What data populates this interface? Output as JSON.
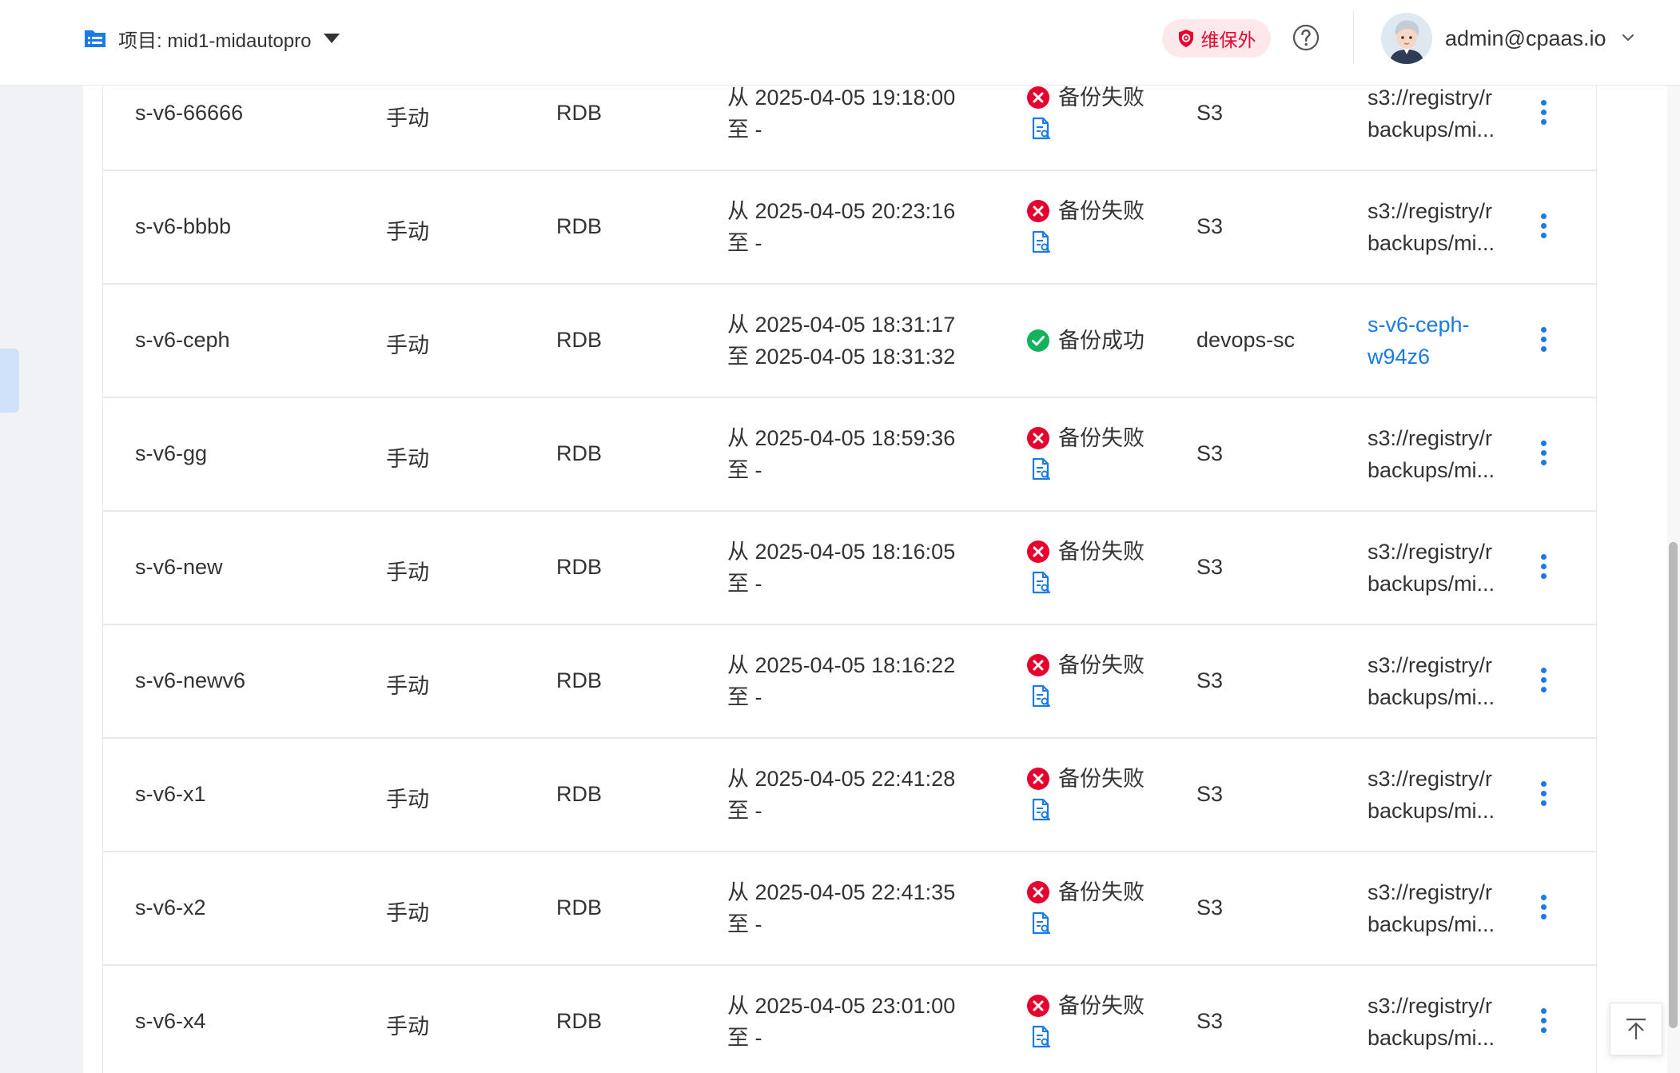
{
  "header": {
    "project_label": "项目: mid1-midautopro",
    "warranty_badge": "维保外",
    "user_email": "admin@cpaas.io"
  },
  "colors": {
    "accent": "#1a7ae6",
    "error": "#e6002d",
    "success": "#12b35a",
    "badge_bg": "#fde8eb",
    "page_bg": "#f0f2f5"
  },
  "icons": [
    "project-icon",
    "caret-down-icon",
    "shield-icon",
    "help-icon",
    "avatar",
    "chevron-down-icon",
    "error-icon",
    "success-icon",
    "log-file-icon",
    "more-icon",
    "back-to-top-icon"
  ],
  "rows": [
    {
      "name": "s-v6-66666",
      "mode": "手动",
      "type": "RDB",
      "time_from": "从 2025-04-05 19:18:00",
      "time_to": "至 -",
      "status": "备份失败",
      "status_kind": "error",
      "storage": "S3",
      "path_line1": "s3://registry/r",
      "path_line2": "backups/mi...",
      "path_is_link": false
    },
    {
      "name": "s-v6-bbbb",
      "mode": "手动",
      "type": "RDB",
      "time_from": "从 2025-04-05 20:23:16",
      "time_to": "至 -",
      "status": "备份失败",
      "status_kind": "error",
      "storage": "S3",
      "path_line1": "s3://registry/r",
      "path_line2": "backups/mi...",
      "path_is_link": false
    },
    {
      "name": "s-v6-ceph",
      "mode": "手动",
      "type": "RDB",
      "time_from": "从 2025-04-05 18:31:17",
      "time_to": "至 2025-04-05 18:31:32",
      "status": "备份成功",
      "status_kind": "success",
      "storage": "devops-sc",
      "path_line1": "s-v6-ceph-",
      "path_line2": "w94z6",
      "path_is_link": true
    },
    {
      "name": "s-v6-gg",
      "mode": "手动",
      "type": "RDB",
      "time_from": "从 2025-04-05 18:59:36",
      "time_to": "至 -",
      "status": "备份失败",
      "status_kind": "error",
      "storage": "S3",
      "path_line1": "s3://registry/r",
      "path_line2": "backups/mi...",
      "path_is_link": false
    },
    {
      "name": "s-v6-new",
      "mode": "手动",
      "type": "RDB",
      "time_from": "从 2025-04-05 18:16:05",
      "time_to": "至 -",
      "status": "备份失败",
      "status_kind": "error",
      "storage": "S3",
      "path_line1": "s3://registry/r",
      "path_line2": "backups/mi...",
      "path_is_link": false
    },
    {
      "name": "s-v6-newv6",
      "mode": "手动",
      "type": "RDB",
      "time_from": "从 2025-04-05 18:16:22",
      "time_to": "至 -",
      "status": "备份失败",
      "status_kind": "error",
      "storage": "S3",
      "path_line1": "s3://registry/r",
      "path_line2": "backups/mi...",
      "path_is_link": false
    },
    {
      "name": "s-v6-x1",
      "mode": "手动",
      "type": "RDB",
      "time_from": "从 2025-04-05 22:41:28",
      "time_to": "至 -",
      "status": "备份失败",
      "status_kind": "error",
      "storage": "S3",
      "path_line1": "s3://registry/r",
      "path_line2": "backups/mi...",
      "path_is_link": false
    },
    {
      "name": "s-v6-x2",
      "mode": "手动",
      "type": "RDB",
      "time_from": "从 2025-04-05 22:41:35",
      "time_to": "至 -",
      "status": "备份失败",
      "status_kind": "error",
      "storage": "S3",
      "path_line1": "s3://registry/r",
      "path_line2": "backups/mi...",
      "path_is_link": false
    },
    {
      "name": "s-v6-x4",
      "mode": "手动",
      "type": "RDB",
      "time_from": "从 2025-04-05 23:01:00",
      "time_to": "至 -",
      "status": "备份失败",
      "status_kind": "error",
      "storage": "S3",
      "path_line1": "s3://registry/r",
      "path_line2": "backups/mi...",
      "path_is_link": false
    }
  ]
}
